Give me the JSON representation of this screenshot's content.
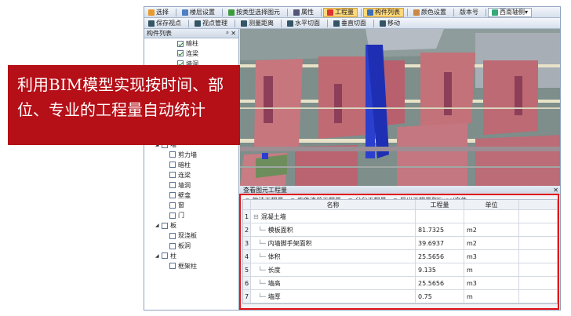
{
  "toolbar_row1": [
    {
      "label": "选择",
      "icon": "cursor-icon",
      "color": "#e89a2c"
    },
    {
      "label": "楼层设置",
      "icon": "layers-icon",
      "color": "#4f7fc2"
    },
    {
      "label": "按类型选择图元",
      "icon": "filter-icon",
      "color": "#3d9b3d"
    },
    {
      "label": "属性",
      "icon": "properties-icon",
      "color": "#557"
    },
    {
      "label": "工程量",
      "icon": "quantity-icon",
      "color": "#d33",
      "active": true
    },
    {
      "label": "构件列表",
      "icon": "list-icon",
      "color": "#3c6fb5",
      "active": true
    },
    {
      "label": "颜色设置",
      "icon": "palette-icon",
      "color": "#c84"
    },
    {
      "label": "版本号",
      "icon": "",
      "color": ""
    },
    {
      "label": "西南轴侧",
      "icon": "view-icon",
      "color": "#3a7",
      "dropdown": true
    }
  ],
  "toolbar_row2": [
    {
      "label": "保存视点",
      "icon": "save-icon",
      "color": "#356"
    },
    {
      "label": "视点管理",
      "icon": "viewpoint-icon",
      "color": "#356"
    },
    {
      "label": "测量距离",
      "icon": "measure-icon",
      "color": "#356"
    },
    {
      "label": "水平切面",
      "icon": "section-h-icon",
      "color": "#356"
    },
    {
      "label": "垂直切面",
      "icon": "section-v-icon",
      "color": "#356"
    },
    {
      "label": "移动",
      "icon": "move-icon",
      "color": "#356"
    }
  ],
  "sidebar": {
    "title": "构件列表",
    "pin": "ᵖ ✕",
    "items": [
      {
        "label": "暗柱",
        "level": 3,
        "checked": true,
        "expander": ""
      },
      {
        "label": "连梁",
        "level": 3,
        "checked": true,
        "expander": ""
      },
      {
        "label": "墙洞",
        "level": 3,
        "checked": true,
        "expander": ""
      },
      {
        "label": "楼梯",
        "level": 3,
        "checked": true,
        "expander": ""
      },
      {
        "label": "自定义构件",
        "level": 2,
        "checked": true,
        "expander": "◢"
      },
      {
        "label": "自定义面",
        "level": 3,
        "checked": true,
        "expander": ""
      },
      {
        "label": "砌筑",
        "level": 0,
        "checked": false,
        "expander": "◢"
      },
      {
        "label": "二次结构",
        "level": 1,
        "checked": false,
        "expander": "◢"
      },
      {
        "label": "砌体墙",
        "level": 2,
        "checked": false,
        "expander": ""
      },
      {
        "label": "圈梁",
        "level": 2,
        "checked": false,
        "expander": ""
      },
      {
        "label": "墙",
        "level": 1,
        "checked": false,
        "expander": "◢"
      },
      {
        "label": "剪力墙",
        "level": 2,
        "checked": false,
        "expander": ""
      },
      {
        "label": "暗柱",
        "level": 2,
        "checked": false,
        "expander": ""
      },
      {
        "label": "连梁",
        "level": 2,
        "checked": false,
        "expander": ""
      },
      {
        "label": "墙洞",
        "level": 2,
        "checked": false,
        "expander": ""
      },
      {
        "label": "壁龛",
        "level": 2,
        "checked": false,
        "expander": ""
      },
      {
        "label": "窗",
        "level": 2,
        "checked": false,
        "expander": ""
      },
      {
        "label": "门",
        "level": 2,
        "checked": false,
        "expander": ""
      },
      {
        "label": "板",
        "level": 1,
        "checked": false,
        "expander": "◢"
      },
      {
        "label": "现浇板",
        "level": 2,
        "checked": false,
        "expander": ""
      },
      {
        "label": "板洞",
        "level": 2,
        "checked": false,
        "expander": ""
      },
      {
        "label": "柱",
        "level": 1,
        "checked": false,
        "expander": "◢"
      },
      {
        "label": "框架柱",
        "level": 2,
        "checked": false,
        "expander": ""
      }
    ]
  },
  "quantity_panel": {
    "title": "查看图元工程量",
    "options": [
      "做法工程量",
      "构件清单工程量",
      "分包工程量",
      "导出工程量到Excel文件"
    ],
    "columns": {
      "name": "名称",
      "quantity": "工程量",
      "unit": "单位"
    },
    "rows": [
      {
        "index": "1",
        "name": "混凝土墙",
        "quantity": "",
        "unit": "",
        "group": true
      },
      {
        "index": "2",
        "name": "模板面积",
        "quantity": "81.7325",
        "unit": "m2"
      },
      {
        "index": "3",
        "name": "内墙脚手架面积",
        "quantity": "39.6937",
        "unit": "m2"
      },
      {
        "index": "4",
        "name": "体积",
        "quantity": "25.5656",
        "unit": "m3"
      },
      {
        "index": "5",
        "name": "长度",
        "quantity": "9.135",
        "unit": "m"
      },
      {
        "index": "6",
        "name": "墙高",
        "quantity": "25.5656",
        "unit": "m3"
      },
      {
        "index": "7",
        "name": "墙厚",
        "quantity": "0.75",
        "unit": "m"
      }
    ]
  },
  "overlay": {
    "line1": "利用BIM模型实现按时间、部",
    "line2": "位、专业的工程量自动统计"
  },
  "colors": {
    "highlight": "#e0141b",
    "overlay": "#b50f17",
    "active": "#ffd87a"
  }
}
